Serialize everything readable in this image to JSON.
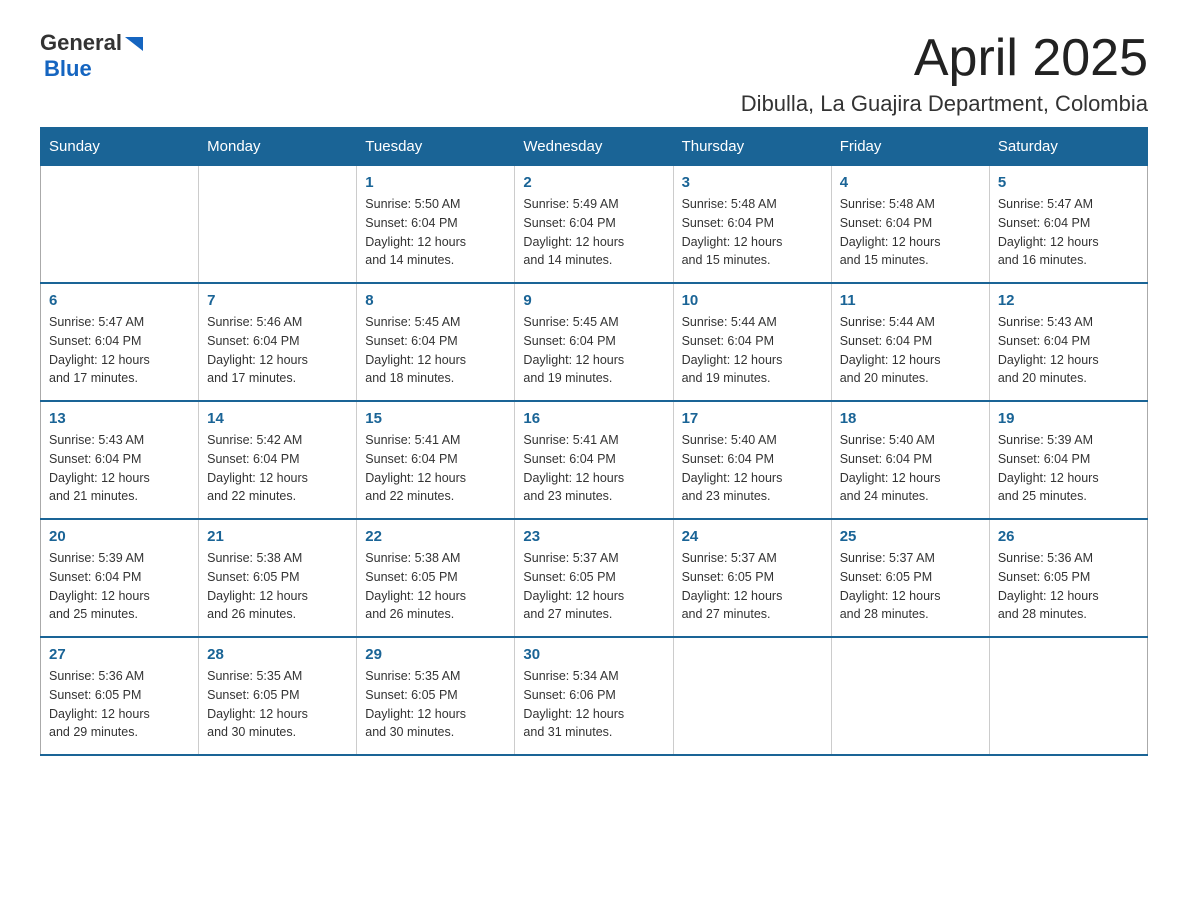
{
  "header": {
    "logo_general": "General",
    "logo_blue": "Blue",
    "month_title": "April 2025",
    "location": "Dibulla, La Guajira Department, Colombia"
  },
  "calendar": {
    "days_of_week": [
      "Sunday",
      "Monday",
      "Tuesday",
      "Wednesday",
      "Thursday",
      "Friday",
      "Saturday"
    ],
    "weeks": [
      [
        {
          "day": "",
          "info": ""
        },
        {
          "day": "",
          "info": ""
        },
        {
          "day": "1",
          "info": "Sunrise: 5:50 AM\nSunset: 6:04 PM\nDaylight: 12 hours\nand 14 minutes."
        },
        {
          "day": "2",
          "info": "Sunrise: 5:49 AM\nSunset: 6:04 PM\nDaylight: 12 hours\nand 14 minutes."
        },
        {
          "day": "3",
          "info": "Sunrise: 5:48 AM\nSunset: 6:04 PM\nDaylight: 12 hours\nand 15 minutes."
        },
        {
          "day": "4",
          "info": "Sunrise: 5:48 AM\nSunset: 6:04 PM\nDaylight: 12 hours\nand 15 minutes."
        },
        {
          "day": "5",
          "info": "Sunrise: 5:47 AM\nSunset: 6:04 PM\nDaylight: 12 hours\nand 16 minutes."
        }
      ],
      [
        {
          "day": "6",
          "info": "Sunrise: 5:47 AM\nSunset: 6:04 PM\nDaylight: 12 hours\nand 17 minutes."
        },
        {
          "day": "7",
          "info": "Sunrise: 5:46 AM\nSunset: 6:04 PM\nDaylight: 12 hours\nand 17 minutes."
        },
        {
          "day": "8",
          "info": "Sunrise: 5:45 AM\nSunset: 6:04 PM\nDaylight: 12 hours\nand 18 minutes."
        },
        {
          "day": "9",
          "info": "Sunrise: 5:45 AM\nSunset: 6:04 PM\nDaylight: 12 hours\nand 19 minutes."
        },
        {
          "day": "10",
          "info": "Sunrise: 5:44 AM\nSunset: 6:04 PM\nDaylight: 12 hours\nand 19 minutes."
        },
        {
          "day": "11",
          "info": "Sunrise: 5:44 AM\nSunset: 6:04 PM\nDaylight: 12 hours\nand 20 minutes."
        },
        {
          "day": "12",
          "info": "Sunrise: 5:43 AM\nSunset: 6:04 PM\nDaylight: 12 hours\nand 20 minutes."
        }
      ],
      [
        {
          "day": "13",
          "info": "Sunrise: 5:43 AM\nSunset: 6:04 PM\nDaylight: 12 hours\nand 21 minutes."
        },
        {
          "day": "14",
          "info": "Sunrise: 5:42 AM\nSunset: 6:04 PM\nDaylight: 12 hours\nand 22 minutes."
        },
        {
          "day": "15",
          "info": "Sunrise: 5:41 AM\nSunset: 6:04 PM\nDaylight: 12 hours\nand 22 minutes."
        },
        {
          "day": "16",
          "info": "Sunrise: 5:41 AM\nSunset: 6:04 PM\nDaylight: 12 hours\nand 23 minutes."
        },
        {
          "day": "17",
          "info": "Sunrise: 5:40 AM\nSunset: 6:04 PM\nDaylight: 12 hours\nand 23 minutes."
        },
        {
          "day": "18",
          "info": "Sunrise: 5:40 AM\nSunset: 6:04 PM\nDaylight: 12 hours\nand 24 minutes."
        },
        {
          "day": "19",
          "info": "Sunrise: 5:39 AM\nSunset: 6:04 PM\nDaylight: 12 hours\nand 25 minutes."
        }
      ],
      [
        {
          "day": "20",
          "info": "Sunrise: 5:39 AM\nSunset: 6:04 PM\nDaylight: 12 hours\nand 25 minutes."
        },
        {
          "day": "21",
          "info": "Sunrise: 5:38 AM\nSunset: 6:05 PM\nDaylight: 12 hours\nand 26 minutes."
        },
        {
          "day": "22",
          "info": "Sunrise: 5:38 AM\nSunset: 6:05 PM\nDaylight: 12 hours\nand 26 minutes."
        },
        {
          "day": "23",
          "info": "Sunrise: 5:37 AM\nSunset: 6:05 PM\nDaylight: 12 hours\nand 27 minutes."
        },
        {
          "day": "24",
          "info": "Sunrise: 5:37 AM\nSunset: 6:05 PM\nDaylight: 12 hours\nand 27 minutes."
        },
        {
          "day": "25",
          "info": "Sunrise: 5:37 AM\nSunset: 6:05 PM\nDaylight: 12 hours\nand 28 minutes."
        },
        {
          "day": "26",
          "info": "Sunrise: 5:36 AM\nSunset: 6:05 PM\nDaylight: 12 hours\nand 28 minutes."
        }
      ],
      [
        {
          "day": "27",
          "info": "Sunrise: 5:36 AM\nSunset: 6:05 PM\nDaylight: 12 hours\nand 29 minutes."
        },
        {
          "day": "28",
          "info": "Sunrise: 5:35 AM\nSunset: 6:05 PM\nDaylight: 12 hours\nand 30 minutes."
        },
        {
          "day": "29",
          "info": "Sunrise: 5:35 AM\nSunset: 6:05 PM\nDaylight: 12 hours\nand 30 minutes."
        },
        {
          "day": "30",
          "info": "Sunrise: 5:34 AM\nSunset: 6:06 PM\nDaylight: 12 hours\nand 31 minutes."
        },
        {
          "day": "",
          "info": ""
        },
        {
          "day": "",
          "info": ""
        },
        {
          "day": "",
          "info": ""
        }
      ]
    ]
  }
}
